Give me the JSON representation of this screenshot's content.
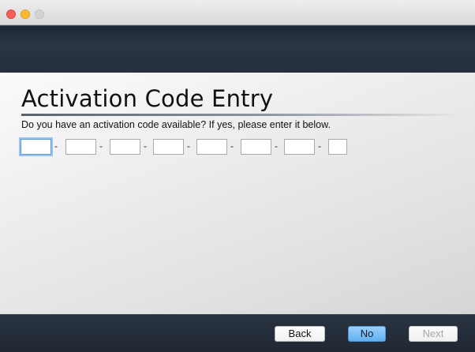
{
  "window": {
    "title": ""
  },
  "page": {
    "title": "Activation Code Entry",
    "prompt": "Do you have an activation code available? If yes, please enter it below."
  },
  "code_entry": {
    "separator": "-",
    "segments": [
      {
        "value": "",
        "focused": true
      },
      {
        "value": ""
      },
      {
        "value": ""
      },
      {
        "value": ""
      },
      {
        "value": ""
      },
      {
        "value": ""
      },
      {
        "value": ""
      },
      {
        "value": ""
      }
    ]
  },
  "footer": {
    "back_label": "Back",
    "no_label": "No",
    "next_label": "Next",
    "next_enabled": false
  },
  "colors": {
    "header_band": "#26303c",
    "primary_button": "#5fb0f2",
    "focus_ring": "#9cc3ec"
  }
}
